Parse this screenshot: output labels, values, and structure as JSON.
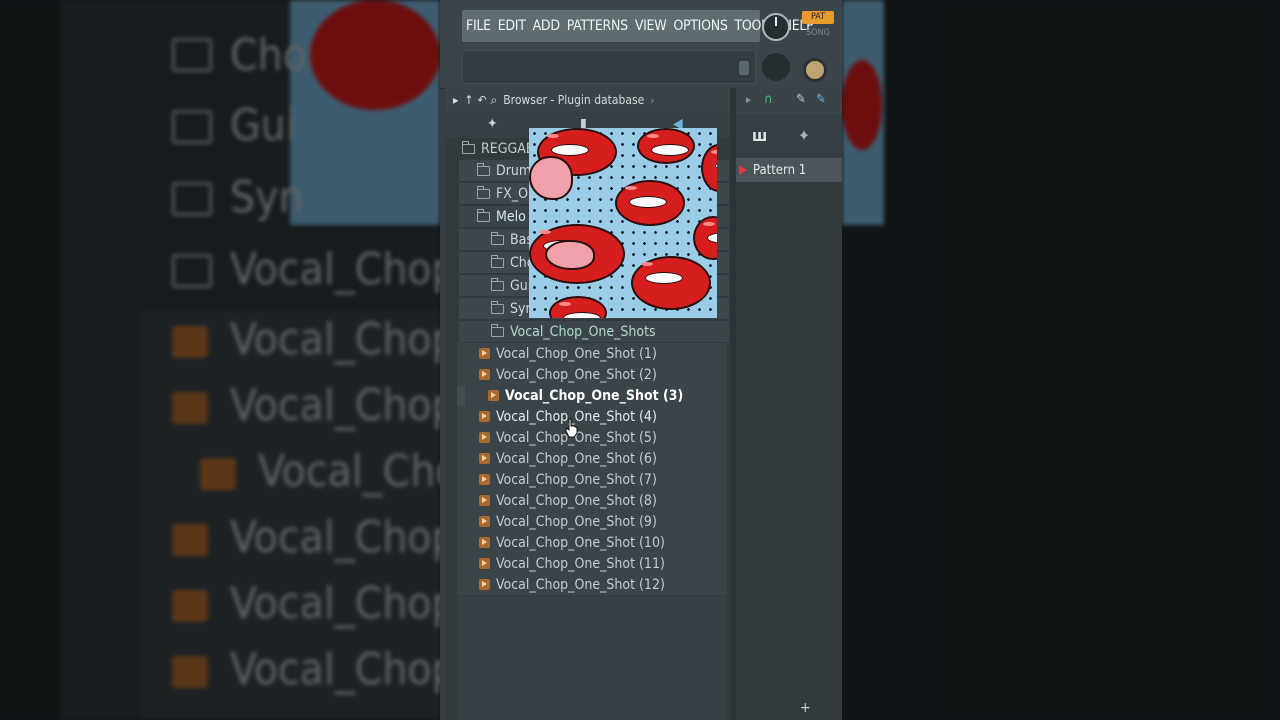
{
  "menu": {
    "items": [
      "FILE",
      "EDIT",
      "ADD",
      "PATTERNS",
      "VIEW",
      "OPTIONS",
      "TOOLS",
      "HELP"
    ]
  },
  "mode": {
    "pat": "PAT",
    "song": "SONG"
  },
  "browser": {
    "title": "Browser - Plugin database",
    "tree": [
      {
        "label": "REGGAE",
        "type": "folder"
      },
      {
        "label": "Drum",
        "type": "folder"
      },
      {
        "label": "FX_O",
        "type": "folder"
      },
      {
        "label": "Melo",
        "type": "folder"
      },
      {
        "label": "Bas",
        "type": "folder"
      },
      {
        "label": "Cho",
        "type": "folder"
      },
      {
        "label": "Gui",
        "type": "folder"
      },
      {
        "label": "Syn",
        "type": "folder"
      },
      {
        "label": "Vocal_Chop_One_Shots",
        "type": "folder"
      }
    ],
    "samples": [
      "Vocal_Chop_One_Shot (1)",
      "Vocal_Chop_One_Shot (2)",
      "Vocal_Chop_One_Shot (3)",
      "Vocal_Chop_One_Shot (4)",
      "Vocal_Chop_One_Shot (5)",
      "Vocal_Chop_One_Shot (6)",
      "Vocal_Chop_One_Shot (7)",
      "Vocal_Chop_One_Shot (8)",
      "Vocal_Chop_One_Shot (9)",
      "Vocal_Chop_One_Shot (10)",
      "Vocal_Chop_One_Shot (11)",
      "Vocal_Chop_One_Shot (12)"
    ],
    "active_sample": "Vocal_Chop_One_Shot (3)"
  },
  "patterns": {
    "item": "Pattern 1",
    "add": "+"
  },
  "background": {
    "rows": [
      "Cho",
      "Gui",
      "Syn",
      "Vocal_Chop",
      "Vocal_Chop",
      "Vocal_Chop",
      "Vocal_Cho",
      "Vocal_Chop",
      "Vocal_Chop",
      "Vocal_Chop"
    ]
  },
  "colors": {
    "accent": "#e99b2b",
    "sample_icon": "#a86a31",
    "pattern_marker": "#e8363a",
    "lips": "#d71e1e",
    "art_bg": "#9ccde8"
  }
}
